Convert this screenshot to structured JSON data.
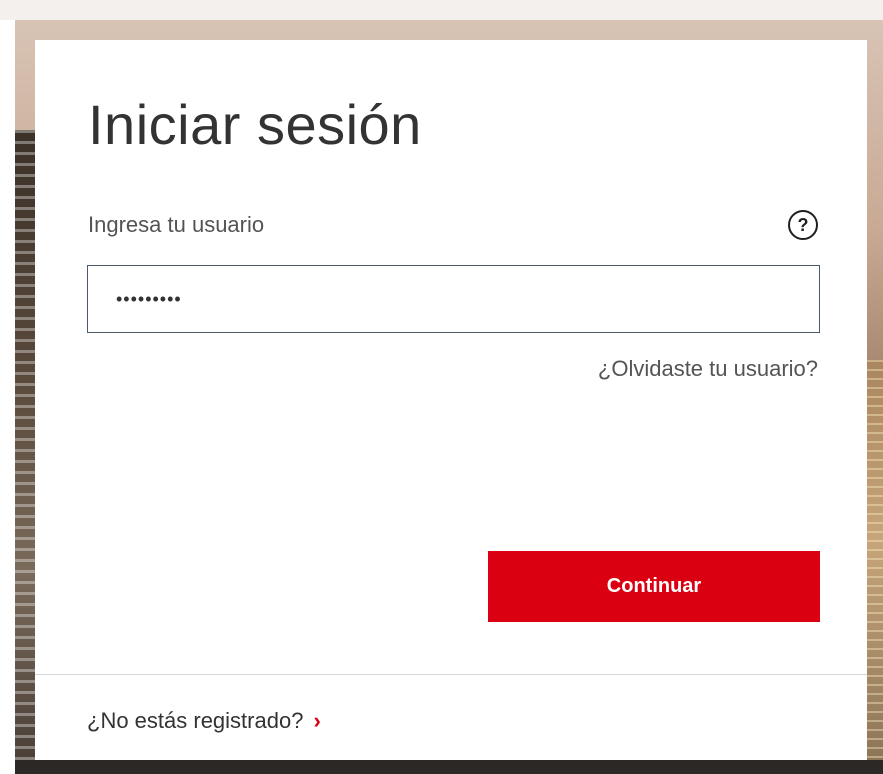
{
  "login": {
    "title": "Iniciar sesión",
    "username_label": "Ingresa tu usuario",
    "help_icon_glyph": "?",
    "username_value": "•••••••••",
    "forgot_username_link": "¿Olvidaste tu usuario?",
    "continue_button_label": "Continuar",
    "register_link": "¿No estás registrado?",
    "register_chevron_glyph": "›"
  },
  "icons": {
    "help": "question-circle-icon",
    "register_arrow": "chevron-right-icon"
  },
  "colors": {
    "brand_red": "#db0011",
    "text_dark": "#333333",
    "text_muted": "#545454",
    "input_border": "#4a5a6a",
    "divider": "#d7d8d6"
  }
}
